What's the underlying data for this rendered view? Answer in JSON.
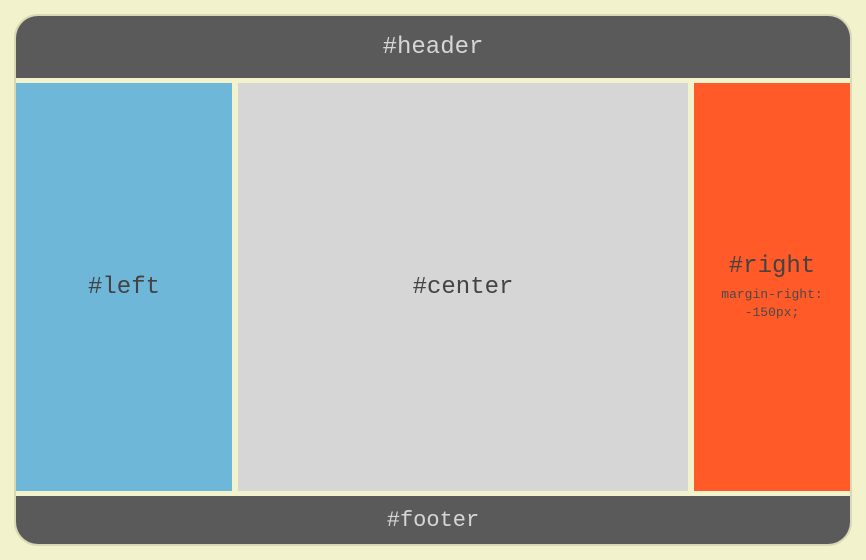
{
  "header": {
    "label": "#header"
  },
  "columns": {
    "left": {
      "label": "#left"
    },
    "center": {
      "label": "#center"
    },
    "right": {
      "label": "#right",
      "caption": "margin-right:\n-150px;"
    }
  },
  "footer": {
    "label": "#footer"
  }
}
